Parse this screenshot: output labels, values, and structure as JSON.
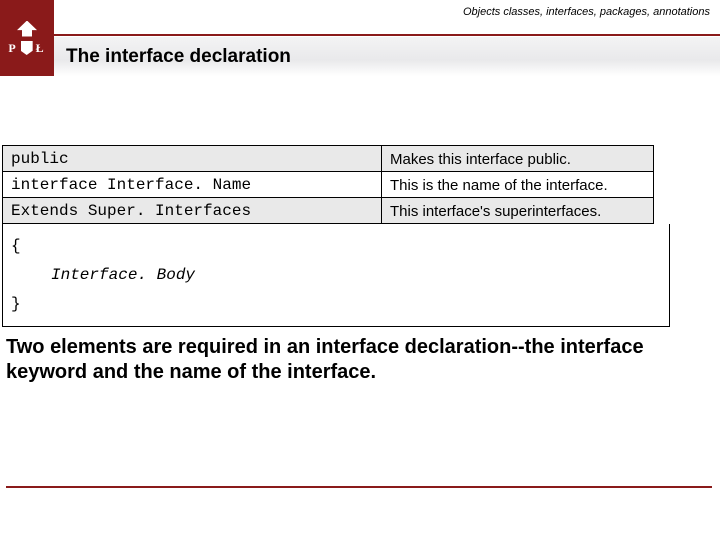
{
  "header": {
    "breadcrumb": "Objects classes, interfaces, packages, annotations",
    "title": "The interface declaration",
    "logo_letters_left": "P",
    "logo_letters_right": "Ł"
  },
  "table": {
    "rows": [
      {
        "code": "public",
        "desc": "Makes this interface public."
      },
      {
        "code": "interface Interface. Name",
        "desc": "This is the name of the interface."
      },
      {
        "code": "Extends Super. Interfaces",
        "desc": "This interface's superinterfaces."
      }
    ]
  },
  "body_block": {
    "open": "{",
    "body": "Interface. Body",
    "close": "}"
  },
  "paragraph": "Two elements are required in an interface declaration--the interface keyword and the name of the interface."
}
